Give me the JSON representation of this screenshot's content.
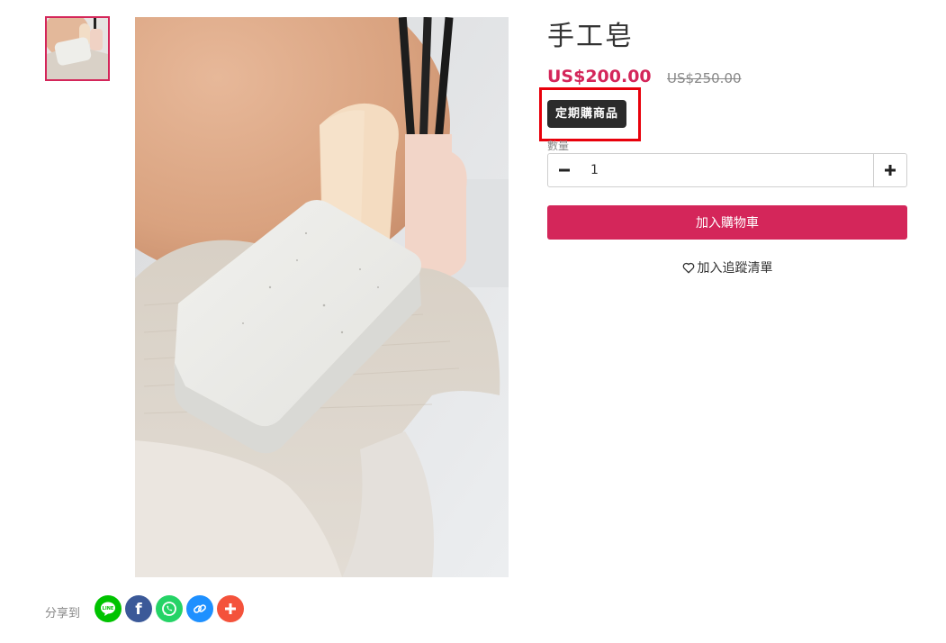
{
  "product": {
    "title": "手工皂",
    "price": "US$200.00",
    "original_price": "US$250.00",
    "badge": "定期購商品",
    "quantity_label": "數量",
    "quantity_value": "1"
  },
  "actions": {
    "add_to_cart": "加入購物車",
    "add_to_wishlist": "加入追蹤清單"
  },
  "share": {
    "label": "分享到",
    "icons": [
      {
        "name": "line-icon",
        "color": "#00c300",
        "glyph": "LINE"
      },
      {
        "name": "facebook-icon",
        "color": "#3b5998",
        "glyph": "f"
      },
      {
        "name": "whatsapp-icon",
        "color": "#25d366"
      },
      {
        "name": "copy-link-icon",
        "color": "#1e90ff"
      },
      {
        "name": "more-share-icon",
        "color": "#f4523b",
        "glyph": "+"
      }
    ]
  },
  "colors": {
    "accent": "#d4265a",
    "badge_bg": "#2b2b2b",
    "highlight_box": "#e8000b"
  }
}
